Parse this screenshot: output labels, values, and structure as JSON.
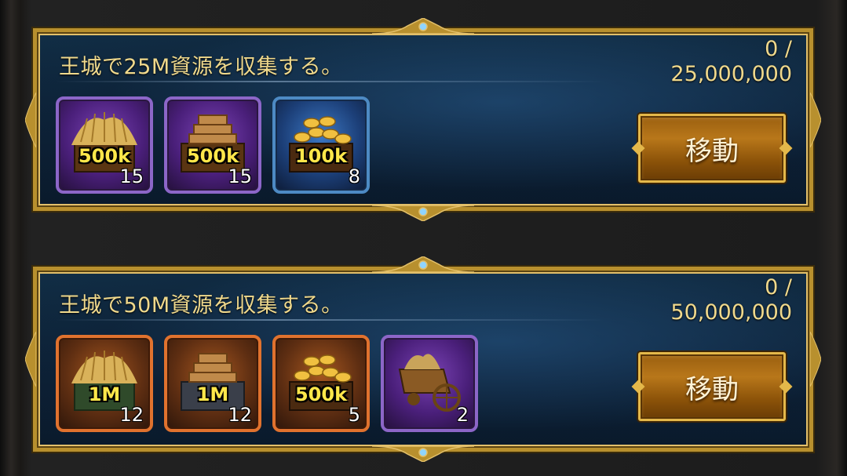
{
  "quests": [
    {
      "title": "王城で25M資源を収集する。",
      "progress_current": "0 /",
      "progress_target": "25,000,000",
      "button_label": "移動",
      "rewards": [
        {
          "icon": "wheat-crate-icon",
          "rarity": "purple",
          "amount": "500k",
          "count": "15"
        },
        {
          "icon": "lumber-crate-icon",
          "rarity": "purple",
          "amount": "500k",
          "count": "15"
        },
        {
          "icon": "gold-chest-icon",
          "rarity": "blue",
          "amount": "100k",
          "count": "8"
        }
      ]
    },
    {
      "title": "王城で50M資源を収集する。",
      "progress_current": "0 /",
      "progress_target": "50,000,000",
      "button_label": "移動",
      "rewards": [
        {
          "icon": "wheat-crate-icon",
          "rarity": "orange",
          "amount": "1M",
          "count": "12"
        },
        {
          "icon": "lumber-crate-icon",
          "rarity": "orange",
          "amount": "1M",
          "count": "12"
        },
        {
          "icon": "gold-chest-icon",
          "rarity": "orange",
          "amount": "500k",
          "count": "5"
        },
        {
          "icon": "supply-cart-icon",
          "rarity": "purple",
          "amount": "",
          "count": "2"
        }
      ]
    }
  ],
  "colors": {
    "gold_border": "#b8902e",
    "title_text": "#f0d98c",
    "amount_text": "#ffe74a",
    "panel_blue": "#0d2238",
    "rarity_purple": "#8c66c8",
    "rarity_blue": "#4d8ac4",
    "rarity_orange": "#e0722e"
  }
}
